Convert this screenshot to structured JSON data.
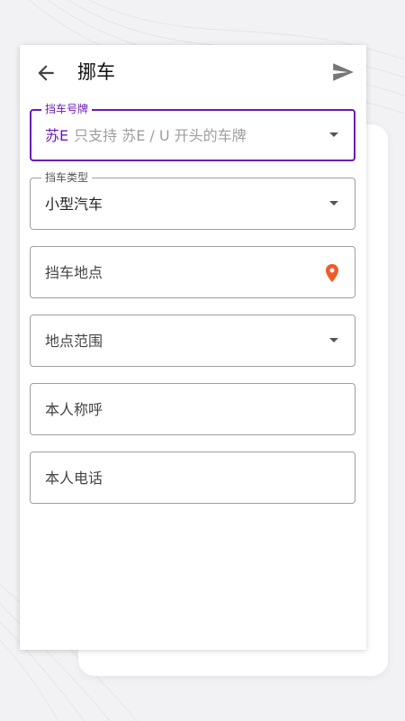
{
  "app_bar": {
    "title": "挪车",
    "back_icon": "arrow-left-icon",
    "send_icon": "send-icon"
  },
  "form": {
    "plate": {
      "label": "挡车号牌",
      "prefix": "苏E",
      "hint": "只支持 苏E / U 开头的车牌",
      "icon": "chevron-down-icon"
    },
    "vehicle_type": {
      "label": "挡车类型",
      "value": "小型汽车",
      "icon": "chevron-down-icon"
    },
    "location": {
      "placeholder": "挡车地点",
      "icon": "location-pin-icon"
    },
    "range": {
      "placeholder": "地点范围",
      "icon": "chevron-down-icon"
    },
    "name": {
      "placeholder": "本人称呼"
    },
    "phone": {
      "placeholder": "本人电话"
    }
  },
  "colors": {
    "accent": "#6a1bb5",
    "pin": "#f05a28",
    "border": "#9e9e9e",
    "hint": "#9e9e9e"
  }
}
